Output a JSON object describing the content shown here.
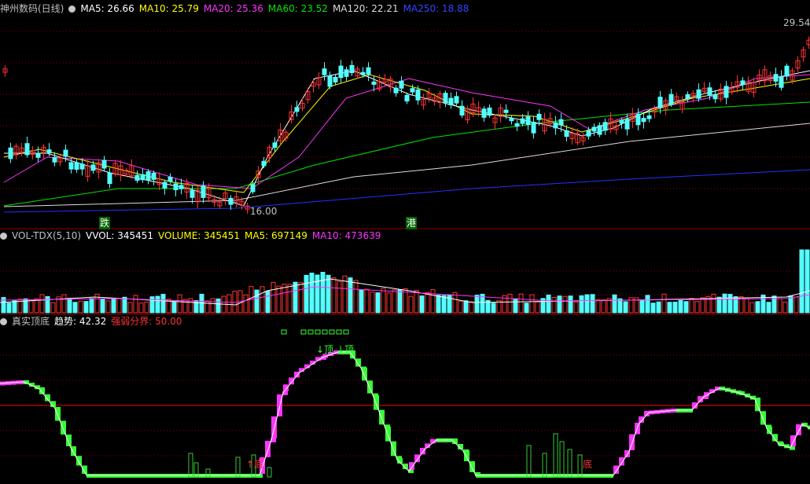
{
  "colors": {
    "up": "#ff3333",
    "down": "#54ffff",
    "ma5": "#ffffff",
    "ma10": "#ffff00",
    "ma20": "#ff33ff",
    "ma60": "#00e600",
    "ma120": "#dcdcdc",
    "ma250": "#2233ff",
    "rise": "#ff33ff",
    "fall": "#33ff33",
    "divider": "#ff0000",
    "grid": "#8b0000"
  },
  "header1": {
    "title": "神州数码(日线)",
    "ma5": "MA5: 26.66",
    "ma10": "MA10: 25.79",
    "ma20": "MA20: 25.36",
    "ma60": "MA60: 23.52",
    "ma120": "MA120: 22.21",
    "ma250": "MA250: 18.88"
  },
  "header2": {
    "name": "VOL-TDX(5,10)",
    "vvol": "VVOL: 345451",
    "volume": "VOLUME: 345451",
    "ma5": "MA5: 697149",
    "ma10": "MA10: 473639"
  },
  "header3": {
    "name": "真实顶底",
    "trend": "趋势: 42.32",
    "divider": "强弱分界: 50.00"
  },
  "labels": {
    "high": "29.54",
    "low": "16.00",
    "mark1": "跌",
    "mark2": "港",
    "top1": "↓顶",
    "top2": "↓顶",
    "bottom1": "↑底",
    "bottom2": "底"
  },
  "chart_data": [
    {
      "type": "line",
      "title": "神州数码(日线)",
      "panel": "price",
      "high_label": 29.54,
      "low_label": 16.0,
      "series": [
        {
          "name": "MA5",
          "last": 26.66
        },
        {
          "name": "MA10",
          "last": 25.79
        },
        {
          "name": "MA20",
          "last": 25.36
        },
        {
          "name": "MA60",
          "last": 23.52
        },
        {
          "name": "MA120",
          "last": 22.21
        },
        {
          "name": "MA250",
          "last": 18.88
        }
      ]
    },
    {
      "type": "bar",
      "title": "VOL-TDX(5,10)",
      "panel": "volume",
      "series": [
        {
          "name": "VVOL",
          "last": 345451
        },
        {
          "name": "VOLUME",
          "last": 345451
        },
        {
          "name": "MA5",
          "last": 697149
        },
        {
          "name": "MA10",
          "last": 473639
        }
      ]
    },
    {
      "type": "line",
      "title": "真实顶底",
      "panel": "indicator",
      "series": [
        {
          "name": "趋势",
          "last": 42.32
        },
        {
          "name": "强弱分界",
          "last": 50.0
        }
      ]
    }
  ]
}
